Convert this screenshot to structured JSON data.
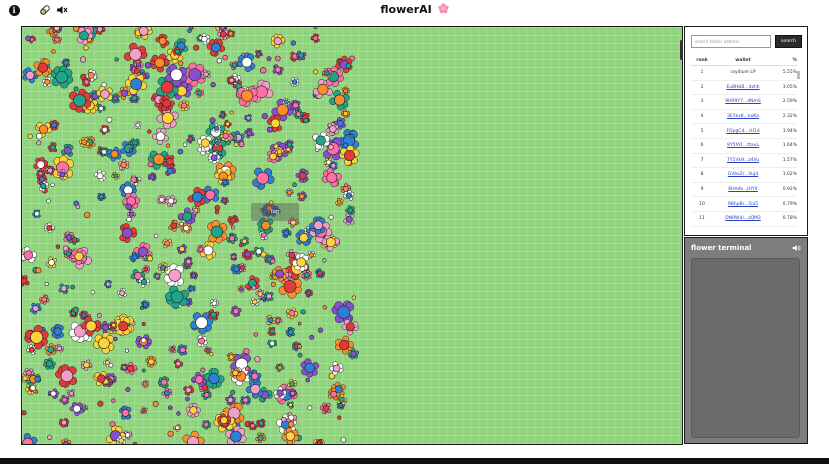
{
  "header": {
    "title": "flowerAI",
    "icons": [
      "info-icon",
      "pill-icon",
      "speaker-mute-icon",
      "flower-icon"
    ]
  },
  "game": {
    "player_label": "tag",
    "colors": {
      "grass": "#8fd47c",
      "petal_palette": [
        "#ff6fa6",
        "#ff8c2a",
        "#ffd23a",
        "#2f7fd6",
        "#8a4fd1",
        "#1fa58a",
        "#e23a3a",
        "#ffffff",
        "#f0a0c8"
      ]
    }
  },
  "leaderboard": {
    "search_placeholder": "search holder address",
    "search_button": "search",
    "columns": [
      "rank",
      "wallet",
      "%"
    ],
    "rows": [
      {
        "rank": "1",
        "wallet": "raydium LP",
        "pct": "5.55%"
      },
      {
        "rank": "2",
        "wallet": "Eu8HbB...dzhh",
        "pct": "3.05%"
      },
      {
        "rank": "3",
        "wallet": "9HR9Y7...dNmS",
        "pct": "2.59%"
      },
      {
        "rank": "4",
        "wallet": "3EYkxK...kxKa",
        "pct": "2.32%"
      },
      {
        "rank": "5",
        "wallet": "FQpgC4...rH1d",
        "pct": "1.94%"
      },
      {
        "rank": "6",
        "wallet": "9Y5fA1...ttauL",
        "pct": "1.64%"
      },
      {
        "rank": "7",
        "wallet": "7Y1Vk9...z4Vu",
        "pct": "1.57%"
      },
      {
        "rank": "8",
        "wallet": "GVbsZr...VuJd",
        "pct": "1.02%"
      },
      {
        "rank": "9",
        "wallet": "6HAdk...JHYX",
        "pct": "0.92%"
      },
      {
        "rank": "10",
        "wallet": "9BhpBr...5ia5",
        "pct": "0.79%"
      },
      {
        "rank": "11",
        "wallet": "DNRW4r...zQM3",
        "pct": "0.78%"
      }
    ]
  },
  "terminal": {
    "title": "flower terminal",
    "sound_icon": "speaker-icon"
  }
}
